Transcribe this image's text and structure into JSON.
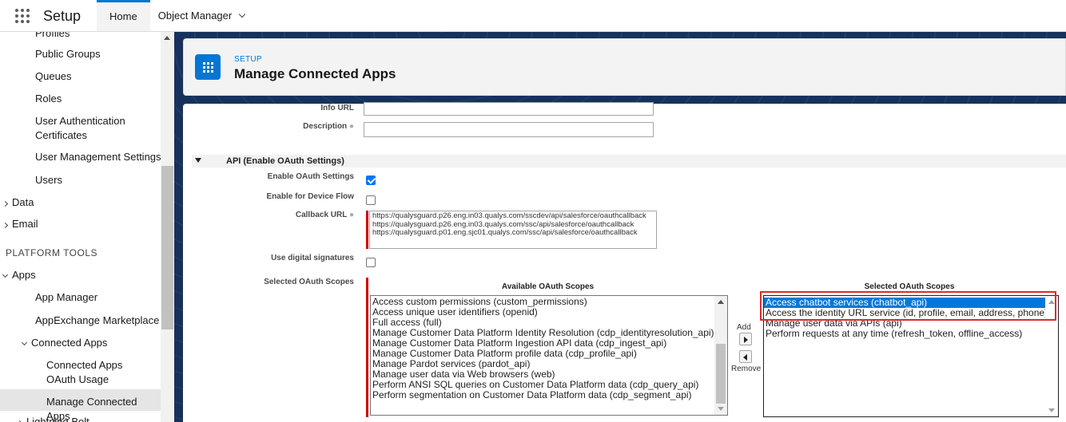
{
  "topbar": {
    "app_name": "Setup",
    "tabs": [
      {
        "label": "Home",
        "active": true
      },
      {
        "label": "Object Manager",
        "active": false
      }
    ]
  },
  "sidebar": {
    "items": [
      {
        "label": "Profiles"
      },
      {
        "label": "Public Groups"
      },
      {
        "label": "Queues"
      },
      {
        "label": "Roles"
      },
      {
        "label": "User Authentication Certificates"
      },
      {
        "label": "User Management Settings"
      },
      {
        "label": "Users"
      },
      {
        "label": "Data"
      },
      {
        "label": "Email"
      },
      {
        "label": "PLATFORM TOOLS"
      },
      {
        "label": "Apps"
      },
      {
        "label": "App Manager"
      },
      {
        "label": "AppExchange Marketplace"
      },
      {
        "label": "Connected Apps"
      },
      {
        "label": "Connected Apps OAuth Usage"
      },
      {
        "label": "Manage Connected Apps"
      },
      {
        "label": "Lightning Bolt"
      }
    ]
  },
  "header": {
    "eyebrow": "SETUP",
    "title": "Manage Connected Apps",
    "icon": "grid-icon"
  },
  "form": {
    "info_url_label": "Info URL",
    "description_label": "Description",
    "section_title": "API (Enable OAuth Settings)",
    "enable_oauth_label": "Enable OAuth Settings",
    "enable_oauth_checked": true,
    "device_flow_label": "Enable for Device Flow",
    "device_flow_checked": false,
    "callback_label": "Callback URL",
    "callback_value": "https://qualysguard.p26.eng.in03.qualys.com/sscdev/api/salesforce/oauthcallback\nhttps://qualysguard.p26.eng.in03.qualys.com/ssc/api/salesforce/oauthcallback\nhttps://qualysguard.p01.eng.sjc01.qualys.com/ssc/api/salesforce/oauthcallback",
    "digital_sig_label": "Use digital signatures",
    "digital_sig_checked": false,
    "scopes_label": "Selected OAuth Scopes",
    "available_header": "Available OAuth Scopes",
    "selected_header": "Selected OAuth Scopes",
    "add_label": "Add",
    "remove_label": "Remove",
    "available_scopes": [
      "Access custom permissions (custom_permissions)",
      "Access unique user identifiers (openid)",
      "Full access (full)",
      "Manage Customer Data Platform Identity Resolution (cdp_identityresolution_api)",
      "Manage Customer Data Platform Ingestion API data (cdp_ingest_api)",
      "Manage Customer Data Platform profile data (cdp_profile_api)",
      "Manage Pardot services (pardot_api)",
      "Manage user data via Web browsers (web)",
      "Perform ANSI SQL queries on Customer Data Platform data (cdp_query_api)",
      "Perform segmentation on Customer Data Platform data (cdp_segment_api)"
    ],
    "selected_scopes": [
      "Access chatbot services (chatbot_api)",
      "Access the identity URL service (id, profile, email, address, phone)",
      "Manage user data via APIs (api)",
      "Perform requests at any time (refresh_token, offline_access)"
    ]
  },
  "colors": {
    "brand": "#0176d3",
    "header_bg": "#16325c",
    "highlight": "#0078d7",
    "annotation": "#d92c2c"
  }
}
